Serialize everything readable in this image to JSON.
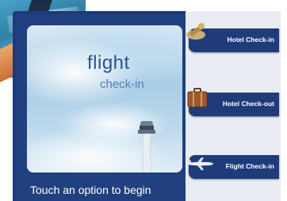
{
  "hero": {
    "title": "flight",
    "subtitle": "check-in",
    "image": "sky-and-control-tower"
  },
  "prompt": "Touch an option to begin",
  "options": [
    {
      "label": "Hotel Check-in",
      "icon": "hotel-key-icon"
    },
    {
      "label": "Hotel Check-out",
      "icon": "suitcase-icon"
    },
    {
      "label": "Flight Check-in",
      "icon": "airplane-icon"
    }
  ],
  "colors": {
    "frame": "#1e3a7c",
    "button": "#1f3b7a",
    "side_panel": "#e9edf3",
    "title_text": "#2c4f8e"
  }
}
